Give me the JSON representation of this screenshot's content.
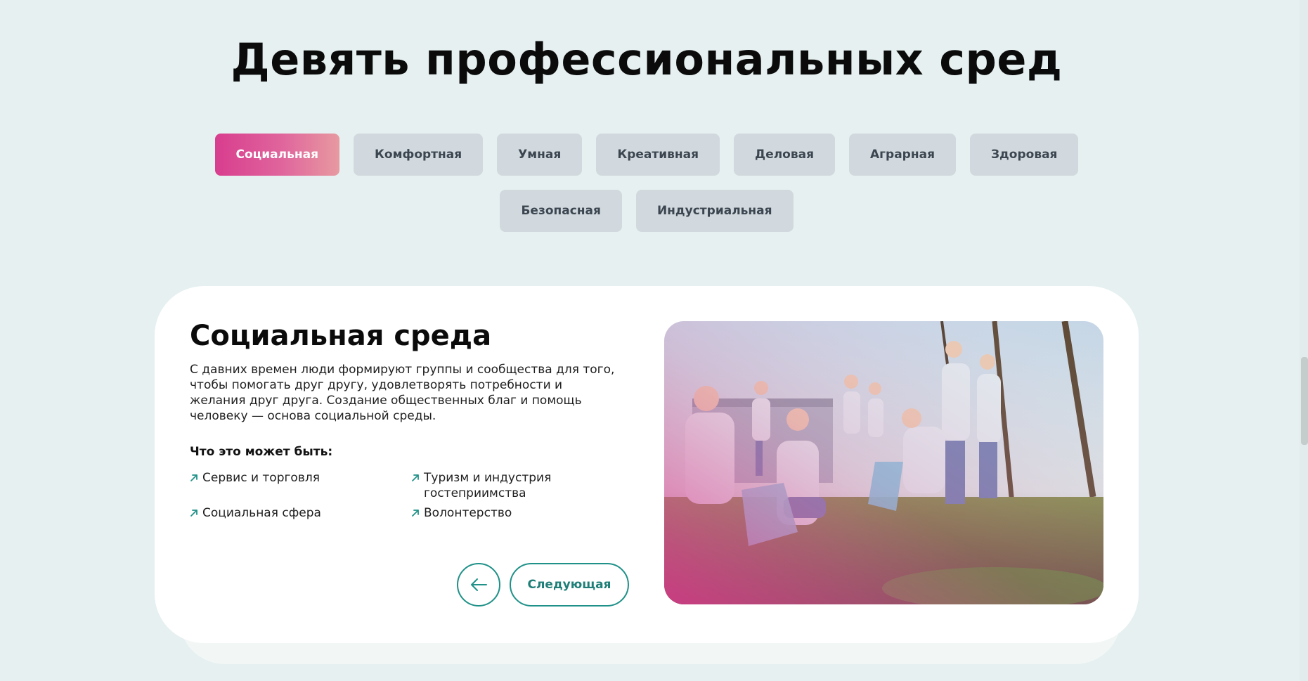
{
  "page": {
    "title": "Девять профессиональных сред"
  },
  "tabs": [
    {
      "label": "Социальная",
      "active": true
    },
    {
      "label": "Комфортная",
      "active": false
    },
    {
      "label": "Умная",
      "active": false
    },
    {
      "label": "Креативная",
      "active": false
    },
    {
      "label": "Деловая",
      "active": false
    },
    {
      "label": "Аграрная",
      "active": false
    },
    {
      "label": "Здоровая",
      "active": false
    },
    {
      "label": "Безопасная",
      "active": false
    },
    {
      "label": "Индустриальная",
      "active": false
    }
  ],
  "card": {
    "title": "Социальная среда",
    "description": "С давних времен люди формируют группы и сообщества для того, чтобы помогать друг другу, удовлетворять потребности и желания друг друга. Создание общественных благ и помощь человеку — основа социальной среды.",
    "subheading": "Что это может быть:",
    "items": [
      "Сервис и торговля",
      "Туризм и индустрия гостеприимства",
      "Социальная сфера",
      "Волонтерство"
    ],
    "next_label": "Следующая"
  },
  "colors": {
    "page_bg": "#e6f0f0",
    "active_tab_from": "#d83d8e",
    "active_tab_to": "#e79aa0",
    "inactive_tab": "#d2d9de",
    "accent_teal": "#1f9188"
  },
  "icons": {
    "list_marker": "arrow-up-right-icon",
    "prev": "arrow-left-icon"
  }
}
